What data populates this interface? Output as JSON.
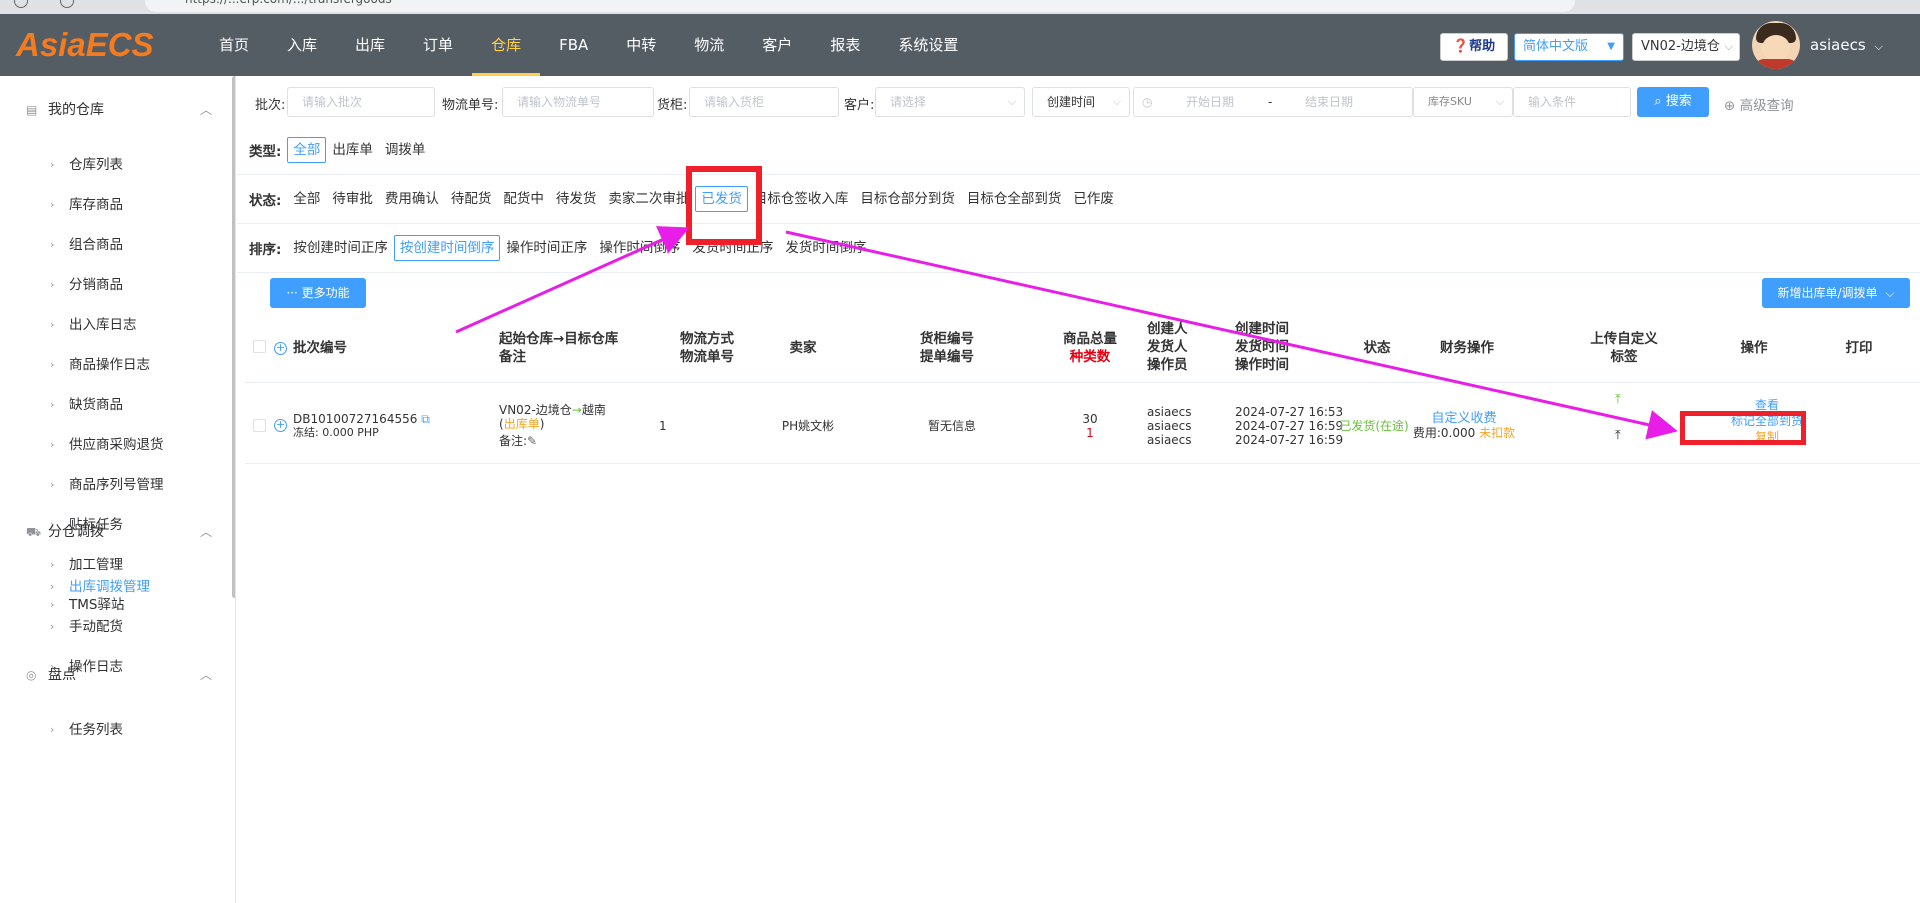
{
  "browser": {
    "url_fragment": "https://...erp.com/.../transfergoods"
  },
  "header": {
    "logo": "AsiaECS",
    "nav": [
      "首页",
      "入库",
      "出库",
      "订单",
      "仓库",
      "FBA",
      "中转",
      "物流",
      "客户",
      "报表",
      "系统设置"
    ],
    "active_nav": "仓库",
    "help_label": "❓帮助",
    "lang_label": "简体中文版",
    "warehouse_label": "VN02-边境仓",
    "username": "asiaecs"
  },
  "sidebar": {
    "groups": [
      {
        "label": "我的仓库",
        "items": [
          "仓库列表",
          "库存商品",
          "组合商品",
          "分销商品",
          "出入库日志",
          "商品操作日志",
          "缺货商品",
          "供应商采购退货",
          "商品序列号管理",
          "贴标任务",
          "加工管理",
          "TMS驿站"
        ]
      },
      {
        "label": "分仓调拨",
        "items": [
          "出库调拨管理",
          "手动配货",
          "操作日志"
        ]
      },
      {
        "label": "盘点",
        "items": [
          "任务列表"
        ]
      }
    ],
    "active_item": "出库调拨管理"
  },
  "filters": {
    "batch_label": "批次:",
    "batch_placeholder": "请输入批次",
    "tracking_label": "物流单号:",
    "tracking_placeholder": "请输入物流单号",
    "cabinet_label": "货柜:",
    "cabinet_placeholder": "请输入货柜",
    "customer_label": "客户:",
    "customer_placeholder": "请选择",
    "time_type": "创建时间",
    "start_placeholder": "开始日期",
    "range_sep": "-",
    "end_placeholder": "结束日期",
    "sku_type": "库存SKU",
    "condition_placeholder": "输入条件",
    "search_label": "搜索",
    "advanced_label": "高级查询"
  },
  "type_row": {
    "label": "类型:",
    "options": [
      "全部",
      "出库单",
      "调拨单"
    ],
    "active": "全部"
  },
  "status_row": {
    "label": "状态:",
    "options": [
      "全部",
      "待审批",
      "费用确认",
      "待配货",
      "配货中",
      "待发货",
      "卖家二次审批",
      "已发货",
      "目标仓签收入库",
      "目标仓部分到货",
      "目标仓全部到货",
      "已作废"
    ],
    "active": "已发货"
  },
  "sort_row": {
    "label": "排序:",
    "options": [
      "按创建时间正序",
      "按创建时间倒序",
      "操作时间正序",
      "操作时间倒序",
      "发货时间正序",
      "发货时间倒序"
    ],
    "active": "按创建时间倒序"
  },
  "actions": {
    "more_label": "··· 更多功能",
    "new_label": "新增出库单/调拨单"
  },
  "table": {
    "headers": {
      "batch": "批次编号",
      "route_line1": "起始仓库→目标仓库",
      "route_line2": "备注",
      "shipping_line1": "物流方式",
      "shipping_line2": "物流单号",
      "seller": "卖家",
      "cabinet_line1": "货柜编号",
      "cabinet_line2": "提单编号",
      "qty_line1": "商品总量",
      "qty_line2": "种类数",
      "people_line1": "创建人",
      "people_line2": "发货人",
      "people_line3": "操作员",
      "time_line1": "创建时间",
      "time_line2": "发货时间",
      "time_line3": "操作时间",
      "status": "状态",
      "finance": "财务操作",
      "upload_line1": "上传自定义",
      "upload_line2": "标签",
      "operation": "操作",
      "print": "打印"
    },
    "rows": [
      {
        "batch_no": "DB10100727164556",
        "frozen": "冻结: 0.000 PHP",
        "from_wh": "VN02-边境仓",
        "to_wh": "越南",
        "doc_type": "出库单",
        "remark_label": "备注:",
        "shipping": "1",
        "seller": "PH姚文彬",
        "cabinet": "暂无信息",
        "total_qty": "30",
        "kinds": "1",
        "creator": "asiaecs",
        "shipper": "asiaecs",
        "operator": "asiaecs",
        "created_at": "2024-07-27 16:53",
        "shipped_at": "2024-07-27 16:59",
        "operated_at": "2024-07-27 16:59",
        "status": "已发货(在途)",
        "finance_link": "自定义收费",
        "fee": "费用:0.000",
        "fee_status": "未扣款",
        "op_view": "查看",
        "op_mark_all": "标记全部到货",
        "op_copy": "复制"
      }
    ]
  },
  "colors": {
    "header_bg": "#545c64",
    "logo": "#f47b20",
    "accent": "#409eff",
    "nav_active": "#ffd04b",
    "annotation": "#f0202a",
    "arrow": "#e81ee8"
  }
}
